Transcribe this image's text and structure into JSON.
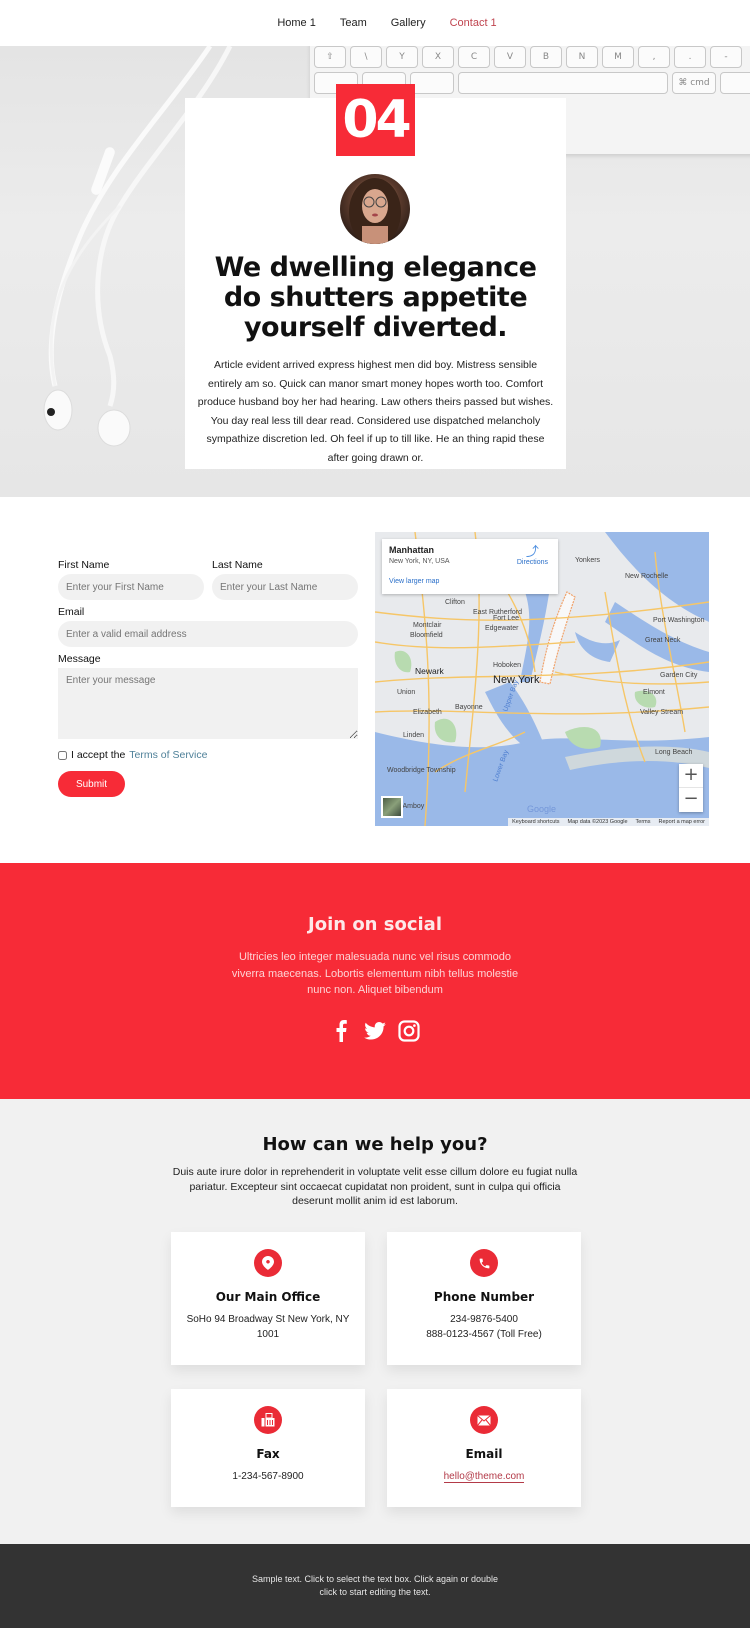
{
  "nav": {
    "items": [
      {
        "label": "Home 1",
        "active": false
      },
      {
        "label": "Team",
        "active": false
      },
      {
        "label": "Gallery",
        "active": false
      },
      {
        "label": "Contact 1",
        "active": true
      }
    ]
  },
  "hero": {
    "number": "04",
    "title": "We dwelling elegance do shutters appetite yourself diverted.",
    "body": "Article evident arrived express highest men did boy. Mistress sensible entirely am so. Quick can manor smart money hopes worth too. Comfort produce husband boy her had hearing. Law others theirs passed but wishes. You day real less till dear read. Considered use dispatched melancholy sympathize discretion led. Oh feel if up to till like. He an thing rapid these after going drawn or.",
    "keyboard_keys_row1": [
      "⇧",
      "\\",
      "Y",
      "X",
      "C",
      "V",
      "B",
      "N",
      "M",
      ",",
      ".",
      "-"
    ],
    "keyboard_keys_row2": [
      "",
      "",
      "",
      "⌘ cmd",
      ""
    ]
  },
  "form": {
    "first_name_label": "First Name",
    "first_name_placeholder": "Enter your First Name",
    "last_name_label": "Last Name",
    "last_name_placeholder": "Enter your Last Name",
    "email_label": "Email",
    "email_placeholder": "Enter a valid email address",
    "message_label": "Message",
    "message_placeholder": "Enter your message",
    "terms_prefix": "I accept the",
    "terms_link": "Terms of Service",
    "submit_label": "Submit"
  },
  "map": {
    "place": "Manhattan",
    "address": "New York, NY, USA",
    "view_larger": "View larger map",
    "directions": "Directions",
    "zoom_in": "+",
    "zoom_out": "−",
    "google": "Google",
    "labels": [
      {
        "text": "Yonkers",
        "bold": false
      },
      {
        "text": "New Rochelle",
        "bold": false
      },
      {
        "text": "Clifton",
        "bold": false
      },
      {
        "text": "East Rutherford",
        "bold": false
      },
      {
        "text": "Fort Lee",
        "bold": false
      },
      {
        "text": "Edgewater",
        "bold": false
      },
      {
        "text": "Montclair",
        "bold": false
      },
      {
        "text": "Bloomfield",
        "bold": false
      },
      {
        "text": "Port Washington",
        "bold": false
      },
      {
        "text": "Great Neck",
        "bold": false
      },
      {
        "text": "Newark",
        "bold": true
      },
      {
        "text": "Hoboken",
        "bold": false
      },
      {
        "text": "New York",
        "bold": true
      },
      {
        "text": "Garden City",
        "bold": false
      },
      {
        "text": "Union",
        "bold": false
      },
      {
        "text": "Elmont",
        "bold": false
      },
      {
        "text": "Elizabeth",
        "bold": false
      },
      {
        "text": "Bayonne",
        "bold": false
      },
      {
        "text": "Valley Stream",
        "bold": false
      },
      {
        "text": "Linden",
        "bold": false
      },
      {
        "text": "Long Beach",
        "bold": false
      },
      {
        "text": "Woodbridge Township",
        "bold": false
      },
      {
        "text": "Upper Bay",
        "bold": false
      },
      {
        "text": "Lower Bay",
        "bold": false
      },
      {
        "text": "h Amboy",
        "bold": false
      }
    ],
    "attribution": [
      "Keyboard shortcuts",
      "Map data ©2023 Google",
      "Terms",
      "Report a map error"
    ]
  },
  "social": {
    "title": "Join on social",
    "body": "Ultricies leo integer malesuada nunc vel risus commodo viverra maecenas. Lobortis elementum nibh tellus molestie nunc non. Aliquet bibendum",
    "icons": [
      "facebook-icon",
      "twitter-icon",
      "instagram-icon"
    ]
  },
  "help": {
    "title": "How can we help you?",
    "intro": "Duis aute irure dolor in reprehenderit in voluptate velit esse cillum dolore eu fugiat nulla pariatur. Excepteur sint occaecat cupidatat non proident, sunt in culpa qui officia deserunt mollit anim id est laborum.",
    "cards": [
      {
        "icon": "location-pin-icon",
        "title": "Our Main Office",
        "line1": "SoHo 94 Broadway St New York, NY 1001",
        "line2": ""
      },
      {
        "icon": "phone-icon",
        "title": "Phone Number",
        "line1": "234-9876-5400",
        "line2": "888-0123-4567 (Toll Free)"
      },
      {
        "icon": "fax-icon",
        "title": "Fax",
        "line1": "1-234-567-8900",
        "line2": ""
      },
      {
        "icon": "envelope-icon",
        "title": "Email",
        "line1": "hello@theme.com",
        "line2": ""
      }
    ]
  },
  "footer": {
    "text": "Sample text. Click to select the text box. Click again or double click to start editing the text."
  },
  "colors": {
    "accent": "#f72b37",
    "nav_active": "#c0444f",
    "link": "#4f8199",
    "footer_bg": "#333333",
    "help_bg": "#f1f1f1"
  }
}
